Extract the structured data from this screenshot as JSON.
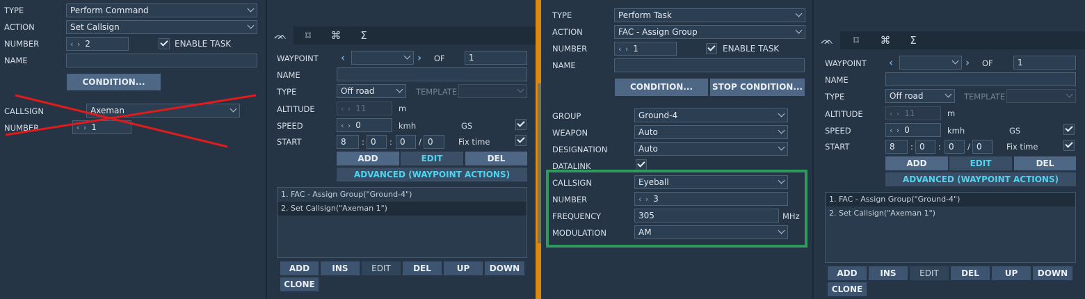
{
  "p1": {
    "type_label": "TYPE",
    "type_value": "Perform Command",
    "action_label": "ACTION",
    "action_value": "Set Callsign",
    "number_label": "NUMBER",
    "number_value": "2",
    "enable_task_label": "ENABLE TASK",
    "name_label": "NAME",
    "condition_button": "CONDITION...",
    "callsign_label": "CALLSIGN",
    "callsign_value": "Axeman",
    "number2_label": "NUMBER",
    "number2_value": "1"
  },
  "p2": {
    "tabs": [
      "route-icon",
      "target-icon",
      "command-icon",
      "sum-icon"
    ],
    "waypoint_label": "WAYPOINT",
    "of_label": "OF",
    "of_value": "1",
    "name_label": "NAME",
    "type_label": "TYPE",
    "type_value": "Off road",
    "template_label": "TEMPLATE",
    "altitude_label": "ALTITUDE",
    "altitude_value": "11",
    "altitude_unit": "m",
    "speed_label": "SPEED",
    "speed_value": "0",
    "speed_unit": "kmh",
    "gs_label": "GS",
    "start_label": "START",
    "start_h": "8",
    "start_m": "0",
    "start_s": "0",
    "start_d": "0",
    "sep1": ":",
    "sep2": ":",
    "sep3": "/",
    "fixtime_label": "Fix time",
    "add": "ADD",
    "edit": "EDIT",
    "del": "DEL",
    "advanced": "ADVANCED (WAYPOINT ACTIONS)",
    "actions": [
      "1. FAC - Assign Group(\"Ground-4\")",
      "2. Set Callsign(\"Axeman 1\")"
    ],
    "b_add": "ADD",
    "b_ins": "INS",
    "b_edit": "EDIT",
    "b_del": "DEL",
    "b_up": "UP",
    "b_down": "DOWN",
    "b_clone": "CLONE"
  },
  "p3": {
    "type_label": "TYPE",
    "type_value": "Perform Task",
    "action_label": "ACTION",
    "action_value": "FAC - Assign Group",
    "number_label": "NUMBER",
    "number_value": "1",
    "enable_task_label": "ENABLE TASK",
    "name_label": "NAME",
    "condition_button": "CONDITION...",
    "stop_condition_button": "STOP CONDITION...",
    "group_label": "GROUP",
    "group_value": "Ground-4",
    "weapon_label": "WEAPON",
    "weapon_value": "Auto",
    "designation_label": "DESIGNATION",
    "designation_value": "Auto",
    "datalink_label": "DATALINK",
    "callsign_label": "CALLSIGN",
    "callsign_value": "Eyeball",
    "number2_label": "NUMBER",
    "number2_value": "3",
    "frequency_label": "FREQUENCY",
    "frequency_value": "305",
    "frequency_unit": "MHz",
    "modulation_label": "MODULATION",
    "modulation_value": "AM"
  },
  "p4": {
    "waypoint_label": "WAYPOINT",
    "of_label": "OF",
    "of_value": "1",
    "name_label": "NAME",
    "type_label": "TYPE",
    "type_value": "Off road",
    "template_label": "TEMPLATE",
    "altitude_label": "ALTITUDE",
    "altitude_value": "11",
    "altitude_unit": "m",
    "speed_label": "SPEED",
    "speed_value": "0",
    "speed_unit": "kmh",
    "gs_label": "GS",
    "start_label": "START",
    "start_h": "8",
    "start_m": "0",
    "start_s": "0",
    "start_d": "0",
    "sep1": ":",
    "sep2": ":",
    "sep3": "/",
    "fixtime_label": "Fix time",
    "add": "ADD",
    "edit": "EDIT",
    "del": "DEL",
    "advanced": "ADVANCED (WAYPOINT ACTIONS)",
    "actions": [
      "1. FAC - Assign Group(\"Ground-4\")",
      "2. Set Callsign(\"Axeman 1\")"
    ],
    "b_add": "ADD",
    "b_ins": "INS",
    "b_edit": "EDIT",
    "b_del": "DEL",
    "b_up": "UP",
    "b_down": "DOWN",
    "b_clone": "CLONE"
  },
  "colors": {
    "strike": "#e01b1b",
    "highlight": "#2e9a5e",
    "accent_text": "#4fd3f0",
    "map_orange": "#d98a12"
  }
}
